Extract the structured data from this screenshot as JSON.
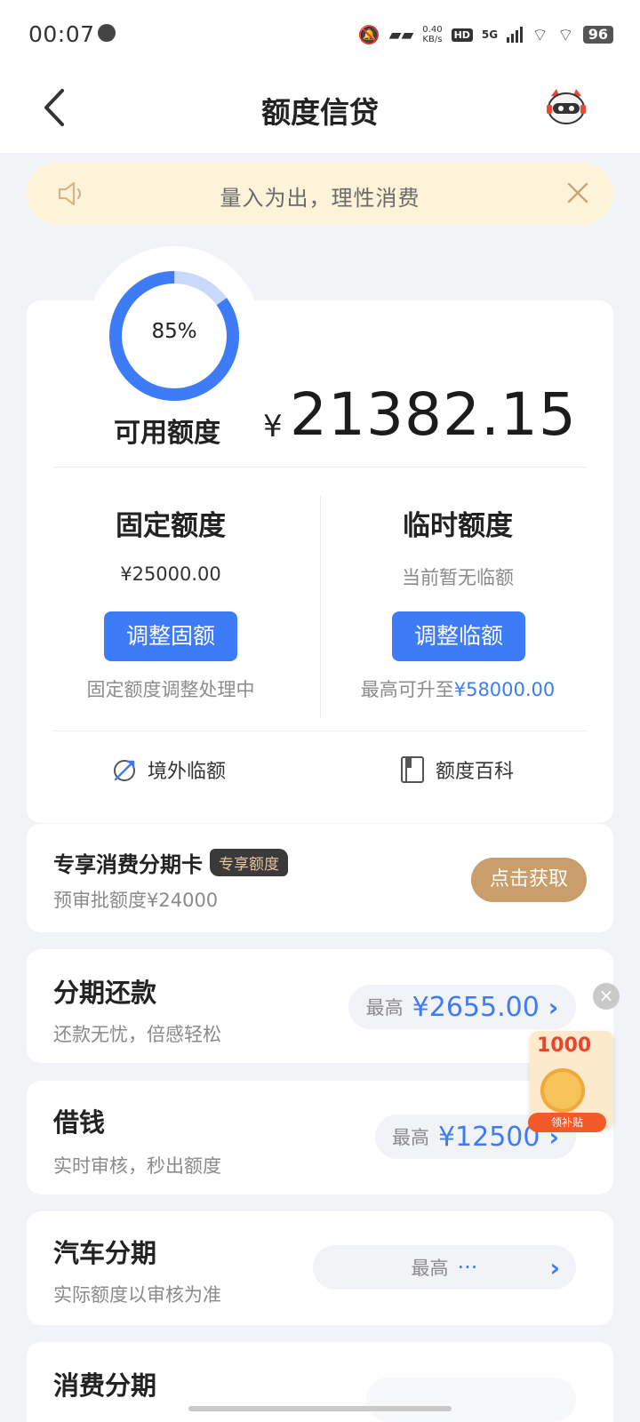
{
  "status_bar": {
    "time": "00:07",
    "net_speed_value": "0.40",
    "net_speed_unit": "KB/s",
    "hd": "HD",
    "network": "5G",
    "battery": "96"
  },
  "header": {
    "title": "额度信贷",
    "icons": [
      "back-arrow-icon",
      "mascot-icon"
    ]
  },
  "notice": {
    "text": "量入为出，理性消费",
    "icons": [
      "speaker-icon",
      "close-icon"
    ]
  },
  "quota": {
    "usage_percent_label": "85%",
    "usage_fraction": 0.85,
    "available_label": "可用额度",
    "currency": "¥",
    "available_amount": "21382.15",
    "fixed": {
      "title": "固定额度",
      "value": "¥25000.00",
      "button": "调整固额",
      "note": "固定额度调整处理中"
    },
    "temporary": {
      "title": "临时额度",
      "value": "当前暂无临额",
      "button": "调整临额",
      "note_prefix": "最高可升至",
      "note_amount": "¥58000.00"
    },
    "links": [
      {
        "label": "境外临额",
        "icon": "plane-globe-icon"
      },
      {
        "label": "额度百科",
        "icon": "book-icon"
      }
    ]
  },
  "cards": {
    "installment_card": {
      "title": "专享消费分期卡",
      "tag": "专享额度",
      "subtitle": "预审批额度¥24000",
      "button": "点击获取"
    },
    "repay": {
      "title": "分期还款",
      "subtitle": "还款无忧，倍感轻松",
      "prefix": "最高",
      "amount": "¥2655.00"
    },
    "loan": {
      "title": "借钱",
      "subtitle": "实时审核，秒出额度",
      "prefix": "最高",
      "amount": "¥12500"
    },
    "car": {
      "title": "汽车分期",
      "subtitle": "实际额度以审核为准",
      "prefix": "最高",
      "amount": "···"
    },
    "consume": {
      "title": "消费分期"
    }
  },
  "float_promo": {
    "amount": "1000",
    "ribbon": "领补贴",
    "close": "×"
  },
  "colors": {
    "accent": "#3d7bf7",
    "gold": "#c99e6a",
    "notice_bg": "#fcf3d9",
    "ring_track": "#c9d9fb"
  }
}
